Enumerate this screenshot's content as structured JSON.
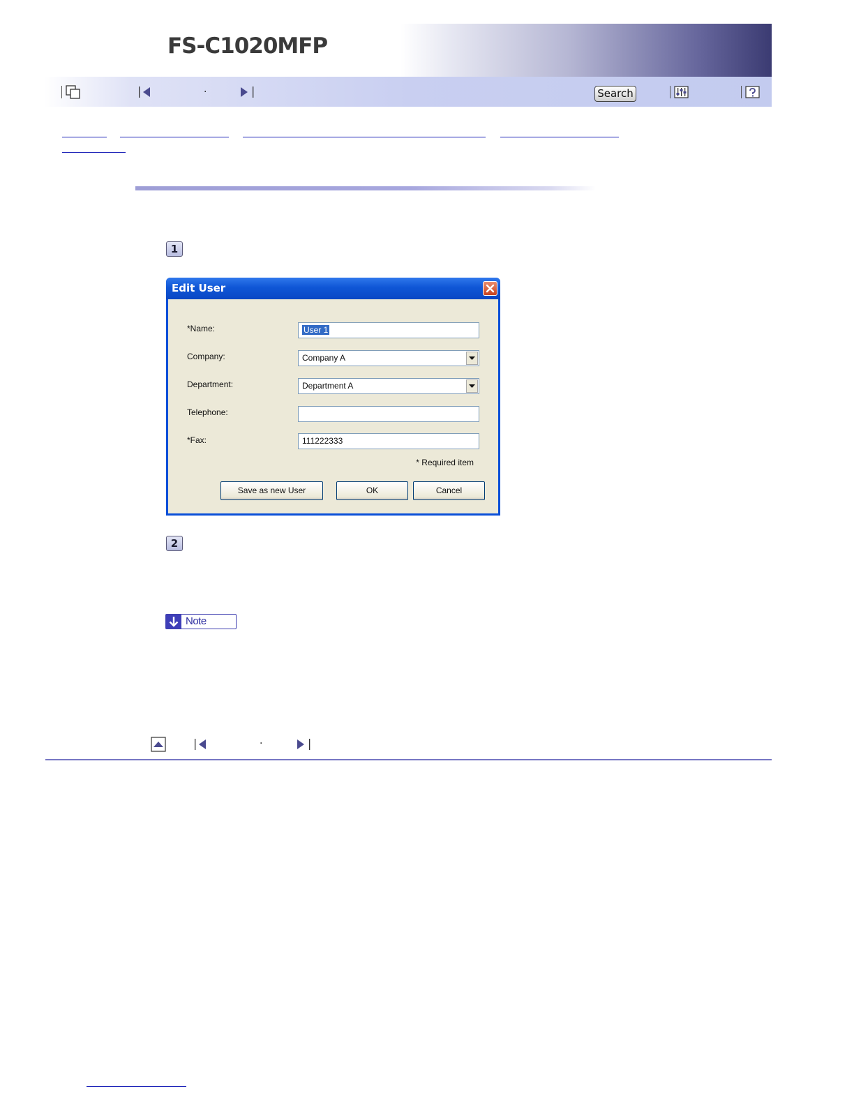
{
  "header": {
    "product_title": "FS-C1020MFP",
    "colors": {
      "banner_dark": "#3b3b72",
      "toolbar": "#c9cff1",
      "link": "#1d23b8"
    }
  },
  "toolbar": {
    "items": [
      {
        "icon": "contents-icon"
      },
      {
        "icon": "previous-icon"
      },
      {
        "icon": "next-icon"
      },
      {
        "icon": "settings-icon"
      },
      {
        "icon": "help-icon"
      }
    ],
    "search_label": "Search",
    "separator_dot": "·"
  },
  "steps": [
    "1",
    "2"
  ],
  "dialog": {
    "title": "Edit User",
    "fields": [
      {
        "label": "*Name:",
        "value": "User 1",
        "type": "text",
        "selected": true
      },
      {
        "label": "Company:",
        "value": "Company A",
        "type": "select"
      },
      {
        "label": "Department:",
        "value": "Department A",
        "type": "select"
      },
      {
        "label": "Telephone:",
        "value": "",
        "type": "text"
      },
      {
        "label": "*Fax:",
        "value": "111222333",
        "type": "text"
      }
    ],
    "required_note": "* Required item",
    "buttons": {
      "save_new": "Save as new User",
      "ok": "OK",
      "cancel": "Cancel"
    }
  },
  "note": {
    "label": "Note"
  },
  "bottom_nav": {
    "items": [
      {
        "icon": "top-icon"
      },
      {
        "icon": "previous-icon"
      },
      {
        "icon": "next-icon"
      }
    ],
    "separator_dot": "·"
  }
}
